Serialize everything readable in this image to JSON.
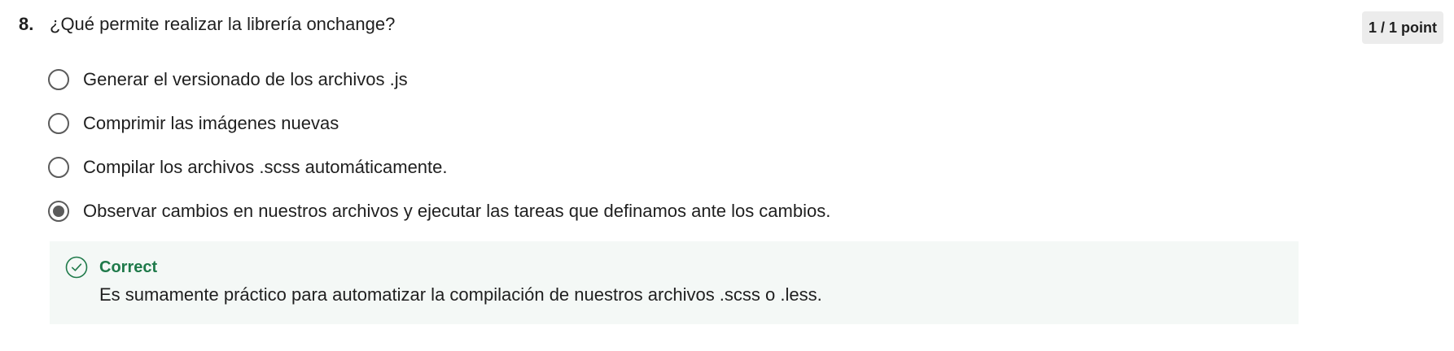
{
  "question": {
    "number": "8.",
    "text": "¿Qué permite realizar la librería onchange?",
    "score": "1 / 1 point"
  },
  "options": [
    {
      "label": "Generar el versionado de los archivos .js",
      "selected": false
    },
    {
      "label": "Comprimir las imágenes nuevas",
      "selected": false
    },
    {
      "label": "Compilar los archivos .scss automáticamente.",
      "selected": false
    },
    {
      "label": "Observar cambios en nuestros archivos y ejecutar las tareas que definamos ante los cambios.",
      "selected": true
    }
  ],
  "feedback": {
    "status": "Correct",
    "message": "Es sumamente práctico para automatizar la compilación de nuestros archivos .scss o .less.",
    "icon": "check-circle-icon",
    "color": "#1f7a4a"
  }
}
